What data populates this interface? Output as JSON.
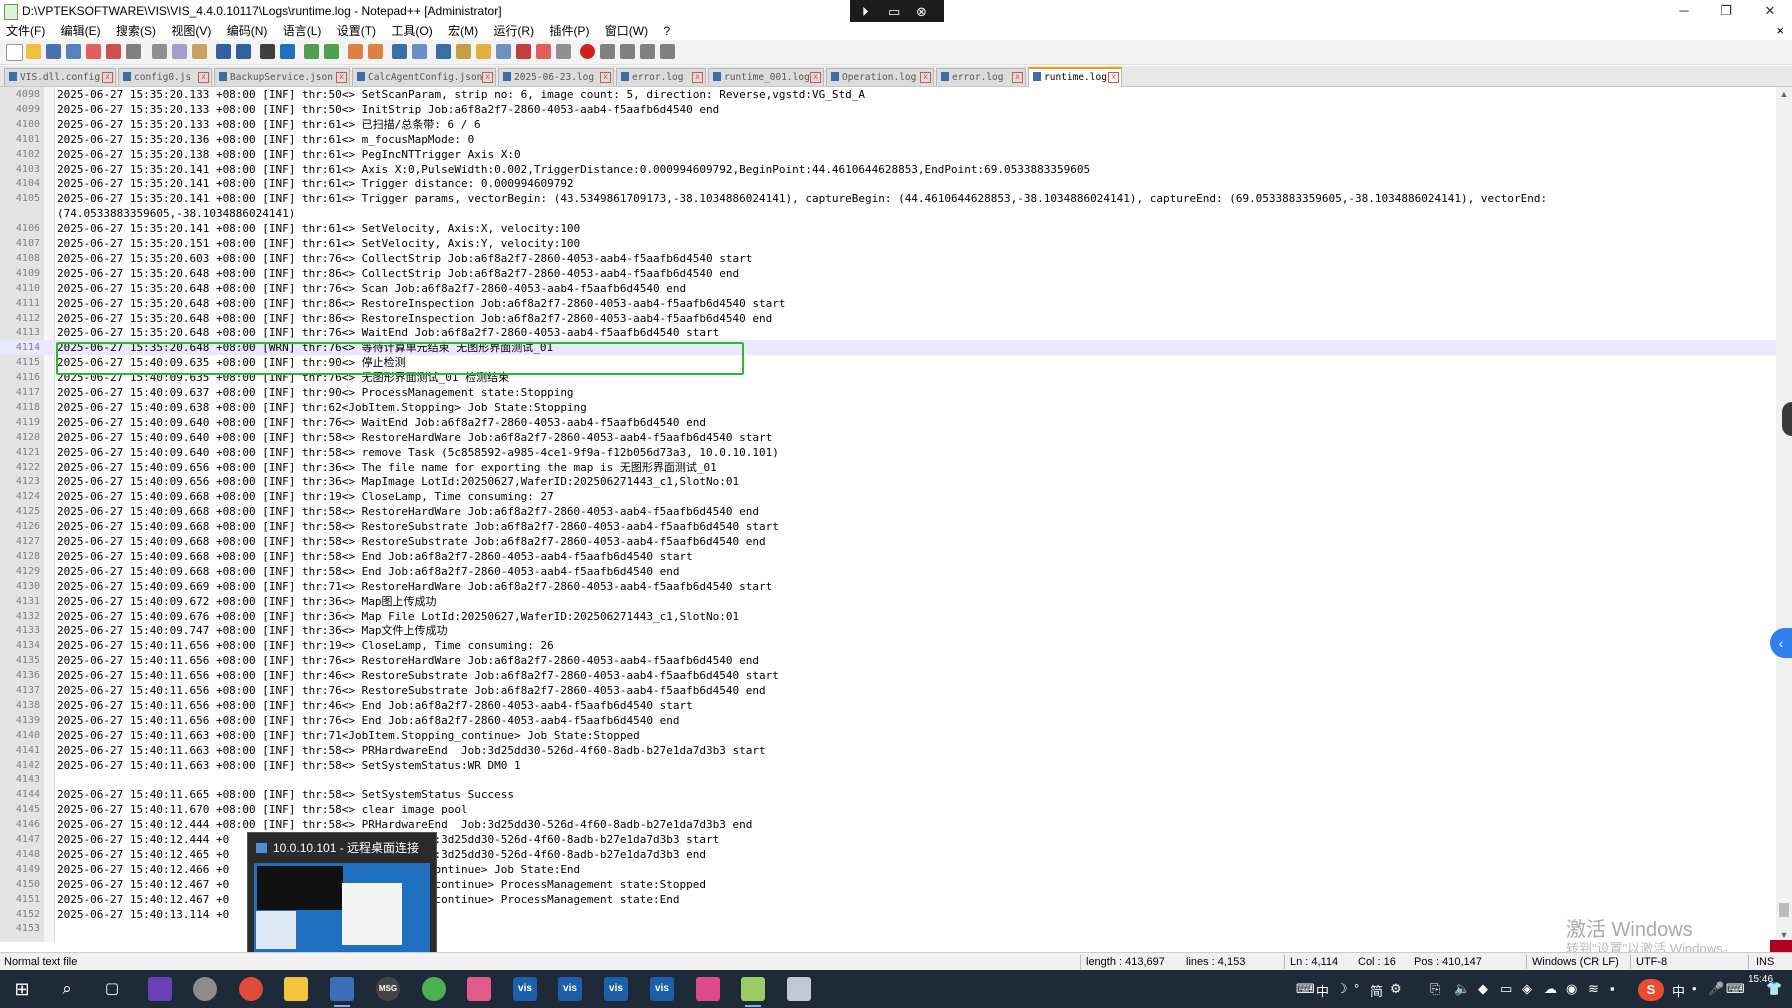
{
  "window": {
    "title": "D:\\VPTEKSOFTWARE\\VIS\\VIS_4.4.0.10117\\Logs\\runtime.log - Notepad++ [Administrator]",
    "min_glyph": "─",
    "restore_glyph": "❐",
    "close_glyph": "✕"
  },
  "rdp_bar": {
    "pin": "⏵",
    "screen": "▭",
    "close": "⊗"
  },
  "menu": {
    "items": [
      "文件(F)",
      "编辑(E)",
      "搜索(S)",
      "视图(V)",
      "编码(N)",
      "语言(L)",
      "设置(T)",
      "工具(O)",
      "宏(M)",
      "运行(R)",
      "插件(P)",
      "窗口(W)",
      "?"
    ],
    "close": "×"
  },
  "tabs": [
    {
      "label": "VIS.dll.config"
    },
    {
      "label": "config0.js"
    },
    {
      "label": "BackupService.json"
    },
    {
      "label": "CalcAgentConfig.json"
    },
    {
      "label": "2025-06-23.log"
    },
    {
      "label": "error.log"
    },
    {
      "label": "runtime_001.log"
    },
    {
      "label": "Operation.log"
    },
    {
      "label": "error.log"
    },
    {
      "label": "runtime.log"
    }
  ],
  "log_lines": [
    {
      "n": "4098",
      "t": "2025-06-27 15:35:20.133 +08:00 [INF] thr:50<> SetScanParam, strip no: 6, image count: 5, direction: Reverse,vgstd:VG_Std_A"
    },
    {
      "n": "4099",
      "t": "2025-06-27 15:35:20.133 +08:00 [INF] thr:50<> InitStrip Job:a6f8a2f7-2860-4053-aab4-f5aafb6d4540 end"
    },
    {
      "n": "4100",
      "t": "2025-06-27 15:35:20.133 +08:00 [INF] thr:61<> 已扫描/总条带: 6 / 6"
    },
    {
      "n": "4101",
      "t": "2025-06-27 15:35:20.136 +08:00 [INF] thr:61<> m_focusMapMode: 0"
    },
    {
      "n": "4102",
      "t": "2025-06-27 15:35:20.138 +08:00 [INF] thr:61<> PegIncNTTrigger Axis X:0"
    },
    {
      "n": "4103",
      "t": "2025-06-27 15:35:20.141 +08:00 [INF] thr:61<> Axis X:0,PulseWidth:0.002,TriggerDistance:0.000994609792,BeginPoint:44.4610644628853,EndPoint:69.0533883359605"
    },
    {
      "n": "4104",
      "t": "2025-06-27 15:35:20.141 +08:00 [INF] thr:61<> Trigger distance: 0.000994609792"
    },
    {
      "n": "4105",
      "t": "2025-06-27 15:35:20.141 +08:00 [INF] thr:61<> Trigger params, vectorBegin: (43.5349861709173,-38.1034886024141), captureBegin: (44.4610644628853,-38.1034886024141), captureEnd: (69.0533883359605,-38.1034886024141), vectorEnd:"
    },
    {
      "n": "",
      "t": "(74.0533883359605,-38.1034886024141)"
    },
    {
      "n": "4106",
      "t": "2025-06-27 15:35:20.141 +08:00 [INF] thr:61<> SetVelocity, Axis:X, velocity:100"
    },
    {
      "n": "4107",
      "t": "2025-06-27 15:35:20.151 +08:00 [INF] thr:61<> SetVelocity, Axis:Y, velocity:100"
    },
    {
      "n": "4108",
      "t": "2025-06-27 15:35:20.603 +08:00 [INF] thr:76<> CollectStrip Job:a6f8a2f7-2860-4053-aab4-f5aafb6d4540 start"
    },
    {
      "n": "4109",
      "t": "2025-06-27 15:35:20.648 +08:00 [INF] thr:86<> CollectStrip Job:a6f8a2f7-2860-4053-aab4-f5aafb6d4540 end"
    },
    {
      "n": "4110",
      "t": "2025-06-27 15:35:20.648 +08:00 [INF] thr:76<> Scan Job:a6f8a2f7-2860-4053-aab4-f5aafb6d4540 end"
    },
    {
      "n": "4111",
      "t": "2025-06-27 15:35:20.648 +08:00 [INF] thr:86<> RestoreInspection Job:a6f8a2f7-2860-4053-aab4-f5aafb6d4540 start"
    },
    {
      "n": "4112",
      "t": "2025-06-27 15:35:20.648 +08:00 [INF] thr:86<> RestoreInspection Job:a6f8a2f7-2860-4053-aab4-f5aafb6d4540 end"
    },
    {
      "n": "4113",
      "t": "2025-06-27 15:35:20.648 +08:00 [INF] thr:76<> WaitEnd Job:a6f8a2f7-2860-4053-aab4-f5aafb6d4540 start"
    },
    {
      "n": "4114",
      "t": "2025-06-27 15:35:20.648 +08:00 [WRN] thr:76<> 等待计算单元结束 无图形界面测试_01",
      "current": true
    },
    {
      "n": "4115",
      "t": "2025-06-27 15:40:09.635 +08:00 [INF] thr:90<> 停止检测"
    },
    {
      "n": "4116",
      "t": "2025-06-27 15:40:09.635 +08:00 [INF] thr:76<> 无图形界面测试_01 检测结束"
    },
    {
      "n": "4117",
      "t": "2025-06-27 15:40:09.637 +08:00 [INF] thr:90<> ProcessManagement state:Stopping"
    },
    {
      "n": "4118",
      "t": "2025-06-27 15:40:09.638 +08:00 [INF] thr:62<JobItem.Stopping> Job State:Stopping"
    },
    {
      "n": "4119",
      "t": "2025-06-27 15:40:09.640 +08:00 [INF] thr:76<> WaitEnd Job:a6f8a2f7-2860-4053-aab4-f5aafb6d4540 end"
    },
    {
      "n": "4120",
      "t": "2025-06-27 15:40:09.640 +08:00 [INF] thr:58<> RestoreHardWare Job:a6f8a2f7-2860-4053-aab4-f5aafb6d4540 start"
    },
    {
      "n": "4121",
      "t": "2025-06-27 15:40:09.640 +08:00 [INF] thr:58<> remove Task (5c858592-a985-4ce1-9f9a-f12b056d73a3, 10.0.10.101)"
    },
    {
      "n": "4122",
      "t": "2025-06-27 15:40:09.656 +08:00 [INF] thr:36<> The file name for exporting the map is 无图形界面测试_01"
    },
    {
      "n": "4123",
      "t": "2025-06-27 15:40:09.656 +08:00 [INF] thr:36<> MapImage LotId:20250627,WaferID:202506271443_c1,SlotNo:01"
    },
    {
      "n": "4124",
      "t": "2025-06-27 15:40:09.668 +08:00 [INF] thr:19<> CloseLamp, Time consuming: 27"
    },
    {
      "n": "4125",
      "t": "2025-06-27 15:40:09.668 +08:00 [INF] thr:58<> RestoreHardWare Job:a6f8a2f7-2860-4053-aab4-f5aafb6d4540 end"
    },
    {
      "n": "4126",
      "t": "2025-06-27 15:40:09.668 +08:00 [INF] thr:58<> RestoreSubstrate Job:a6f8a2f7-2860-4053-aab4-f5aafb6d4540 start"
    },
    {
      "n": "4127",
      "t": "2025-06-27 15:40:09.668 +08:00 [INF] thr:58<> RestoreSubstrate Job:a6f8a2f7-2860-4053-aab4-f5aafb6d4540 end"
    },
    {
      "n": "4128",
      "t": "2025-06-27 15:40:09.668 +08:00 [INF] thr:58<> End Job:a6f8a2f7-2860-4053-aab4-f5aafb6d4540 start"
    },
    {
      "n": "4129",
      "t": "2025-06-27 15:40:09.668 +08:00 [INF] thr:58<> End Job:a6f8a2f7-2860-4053-aab4-f5aafb6d4540 end"
    },
    {
      "n": "4130",
      "t": "2025-06-27 15:40:09.669 +08:00 [INF] thr:71<> RestoreHardWare Job:a6f8a2f7-2860-4053-aab4-f5aafb6d4540 start"
    },
    {
      "n": "4131",
      "t": "2025-06-27 15:40:09.672 +08:00 [INF] thr:36<> Map图上传成功"
    },
    {
      "n": "4132",
      "t": "2025-06-27 15:40:09.676 +08:00 [INF] thr:36<> Map File LotId:20250627,WaferID:202506271443_c1,SlotNo:01"
    },
    {
      "n": "4133",
      "t": "2025-06-27 15:40:09.747 +08:00 [INF] thr:36<> Map文件上传成功"
    },
    {
      "n": "4134",
      "t": "2025-06-27 15:40:11.656 +08:00 [INF] thr:19<> CloseLamp, Time consuming: 26"
    },
    {
      "n": "4135",
      "t": "2025-06-27 15:40:11.656 +08:00 [INF] thr:76<> RestoreHardWare Job:a6f8a2f7-2860-4053-aab4-f5aafb6d4540 end"
    },
    {
      "n": "4136",
      "t": "2025-06-27 15:40:11.656 +08:00 [INF] thr:46<> RestoreSubstrate Job:a6f8a2f7-2860-4053-aab4-f5aafb6d4540 start"
    },
    {
      "n": "4137",
      "t": "2025-06-27 15:40:11.656 +08:00 [INF] thr:76<> RestoreSubstrate Job:a6f8a2f7-2860-4053-aab4-f5aafb6d4540 end"
    },
    {
      "n": "4138",
      "t": "2025-06-27 15:40:11.656 +08:00 [INF] thr:46<> End Job:a6f8a2f7-2860-4053-aab4-f5aafb6d4540 start"
    },
    {
      "n": "4139",
      "t": "2025-06-27 15:40:11.656 +08:00 [INF] thr:76<> End Job:a6f8a2f7-2860-4053-aab4-f5aafb6d4540 end"
    },
    {
      "n": "4140",
      "t": "2025-06-27 15:40:11.663 +08:00 [INF] thr:71<JobItem.Stopping_continue> Job State:Stopped"
    },
    {
      "n": "4141",
      "t": "2025-06-27 15:40:11.663 +08:00 [INF] thr:58<> PRHardwareEnd  Job:3d25dd30-526d-4f60-8adb-b27e1da7d3b3 start"
    },
    {
      "n": "4142",
      "t": "2025-06-27 15:40:11.663 +08:00 [INF] thr:58<> SetSystemStatus:WR DM0 1"
    },
    {
      "n": "4143",
      "t": ""
    },
    {
      "n": "4144",
      "t": "2025-06-27 15:40:11.665 +08:00 [INF] thr:58<> SetSystemStatus Success"
    },
    {
      "n": "4145",
      "t": "2025-06-27 15:40:11.670 +08:00 [INF] thr:58<> clear image pool"
    },
    {
      "n": "4146",
      "t": "2025-06-27 15:40:12.444 +08:00 [INF] thr:58<> PRHardwareEnd  Job:3d25dd30-526d-4f60-8adb-b27e1da7d3b3 end"
    },
    {
      "n": "4147",
      "t": "2025-06-27 15:40:12.444 +0                      Reset Job:3d25dd30-526d-4f60-8adb-b27e1da7d3b3 start"
    },
    {
      "n": "4148",
      "t": "2025-06-27 15:40:12.465 +0                      Reset Job:3d25dd30-526d-4f60-8adb-b27e1da7d3b3 end"
    },
    {
      "n": "4149",
      "t": "2025-06-27 15:40:12.466 +0                      Stopped_continue> Job State:End"
    },
    {
      "n": "4150",
      "t": "2025-06-27 15:40:12.467 +0                      Stopping_continue> ProcessManagement state:Stopped"
    },
    {
      "n": "4151",
      "t": "2025-06-27 15:40:12.467 +0                      Stopping_continue> ProcessManagement state:End"
    },
    {
      "n": "4152",
      "t": "2025-06-27 15:40:13.114 +0                      结束"
    },
    {
      "n": "4153",
      "t": ""
    }
  ],
  "rdp_thumbnail": {
    "title": "10.0.10.101 - 远程桌面连接"
  },
  "watermark": {
    "title": "激活 Windows",
    "subtitle": "转到\"设置\"以激活 Windows。"
  },
  "status": {
    "type": "Normal text file",
    "length": "length : 413,697",
    "lines": "lines : 4,153",
    "ln": "Ln : 4,114",
    "col": "Col : 16",
    "pos": "Pos : 410,147",
    "eol": "Windows (CR LF)",
    "encoding": "UTF-8",
    "mode": "INS"
  },
  "taskbar": {
    "vis_label": "vis",
    "msg_label": "MSG",
    "tray_text": [
      "⌨",
      "中",
      "☽",
      "°",
      "简",
      "⚙"
    ],
    "ime_text": "中",
    "sogou": "S",
    "clock": "15:46"
  },
  "colors": {
    "highlight_box": "#2eb82e",
    "active_tab_accent": "#f2a000",
    "current_line": "#e8e8ff"
  }
}
